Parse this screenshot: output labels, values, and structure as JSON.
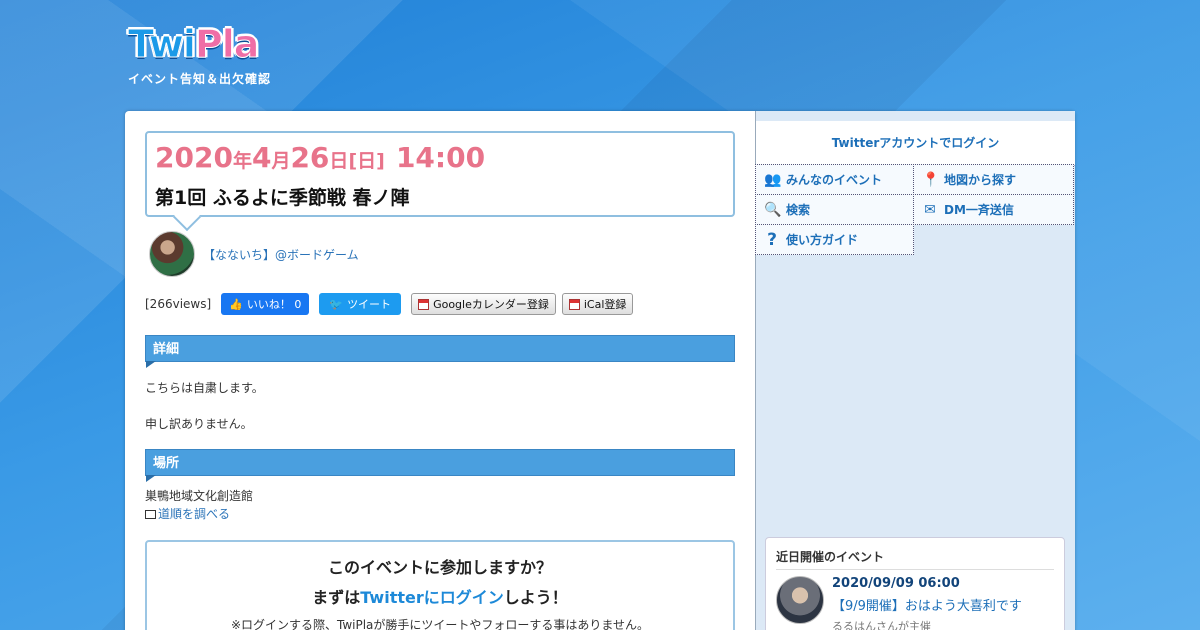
{
  "logo": {
    "part1": "Twi",
    "part2": "Pla",
    "subtitle": "イベント告知＆出欠確認"
  },
  "event": {
    "year": "2020",
    "year_unit": "年",
    "month": "4",
    "month_unit": "月",
    "day": "26",
    "day_unit": "日",
    "weekday": "[日]",
    "time": "14:00",
    "title": "第1回 ふるよに季節戦 春ノ陣"
  },
  "owner": {
    "name": "【なないち】@ボードゲーム"
  },
  "meta": {
    "views": "[266views]",
    "like_label": "いいね！ 0",
    "tweet_label": "ツイート",
    "gcal_label": "Googleカレンダー登録",
    "ical_label": "iCal登録"
  },
  "details": {
    "heading": "詳細",
    "line1": "こちらは自粛します。",
    "line2": "申し訳ありません。"
  },
  "place": {
    "heading": "場所",
    "name": "巣鴨地域文化創造館",
    "directions_label": "道順を調べる"
  },
  "join": {
    "question": "このイベントに参加しますか？",
    "login_prefix": "まずは",
    "login_link": "Twitterにログイン",
    "login_suffix": "しよう！",
    "note": "※ログインする際、TwiPlaが勝手にツイートやフォローする事はありません。"
  },
  "sidebar": {
    "login_label": "Twitterアカウントでログイン",
    "menu": [
      {
        "label": "みんなのイベント",
        "icon": "users-icon",
        "glyph": "👥"
      },
      {
        "label": "地図から探す",
        "icon": "map-pin-icon",
        "glyph": "📍"
      },
      {
        "label": "検索",
        "icon": "search-icon",
        "glyph": "🔍"
      },
      {
        "label": "DM一斉送信",
        "icon": "envelope-icon",
        "glyph": "✉"
      },
      {
        "label": "使い方ガイド",
        "icon": "question-icon",
        "glyph": "?"
      }
    ],
    "recent": {
      "heading": "近日開催のイベント",
      "items": [
        {
          "date": "2020/09/09 06:00",
          "title": "【9/9開催】おはよう大喜利です",
          "host": "るるはんさんが主催"
        }
      ]
    }
  },
  "colors": {
    "accent": "#4a9fdf",
    "date": "#e8738a",
    "link": "#2a73b8"
  }
}
